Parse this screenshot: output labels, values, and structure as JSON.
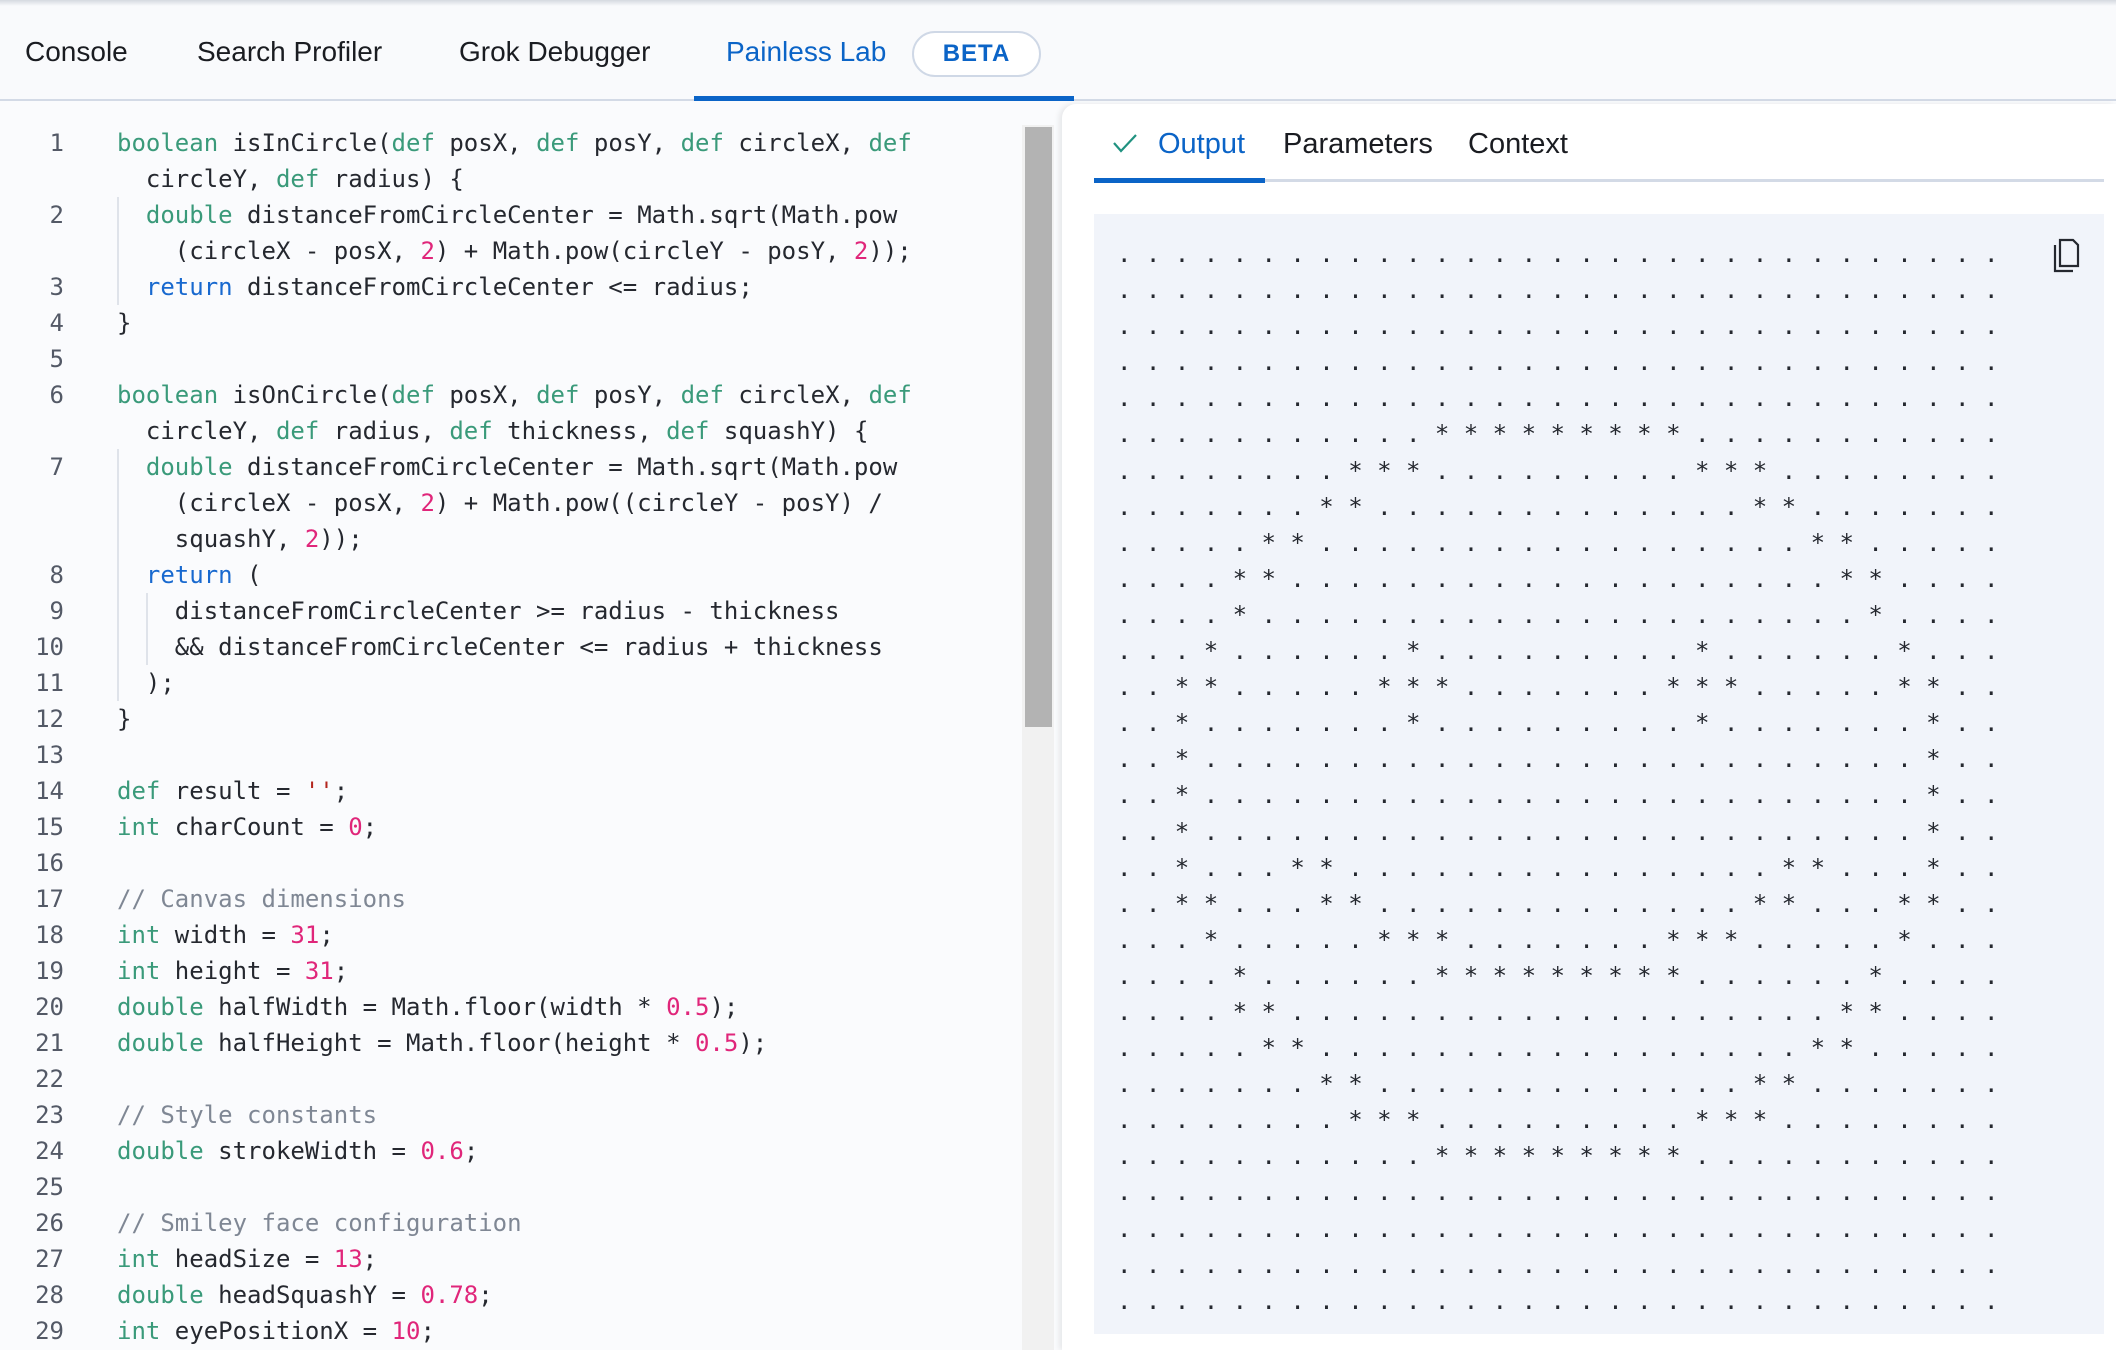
{
  "tabs": [
    {
      "label": "Console",
      "active": false
    },
    {
      "label": "Search Profiler",
      "active": false
    },
    {
      "label": "Grok Debugger",
      "active": false
    },
    {
      "label": "Painless Lab",
      "active": true
    }
  ],
  "beta_badge": "BETA",
  "colors": {
    "accent": "#0b64c7",
    "keyword": "#3a9a7a",
    "return_keyword": "#1869cf",
    "number": "#e0267a",
    "string": "#b3261e",
    "comment": "#7f8794",
    "output_bg": "#f1f4fa"
  },
  "editor": {
    "lines": [
      {
        "n": "1",
        "rows": [
          [
            [
              "k",
              "boolean"
            ],
            [
              "t",
              " isInCircle("
            ],
            [
              "k",
              "def"
            ],
            [
              "t",
              " posX, "
            ],
            [
              "k",
              "def"
            ],
            [
              "t",
              " posY, "
            ],
            [
              "k",
              "def"
            ],
            [
              "t",
              " circleX, "
            ],
            [
              "k",
              "def"
            ]
          ],
          [
            [
              "t",
              "circleY, "
            ],
            [
              "k",
              "def"
            ],
            [
              "t",
              " radius) {"
            ]
          ]
        ]
      },
      {
        "n": "2",
        "rows": [
          [
            [
              "t",
              "  "
            ],
            [
              "k",
              "double"
            ],
            [
              "t",
              " distanceFromCircleCenter = Math.sqrt(Math.pow"
            ]
          ],
          [
            [
              "t",
              "(circleX - posX, "
            ],
            [
              "n",
              "2"
            ],
            [
              "t",
              ") + Math.pow(circleY - posY, "
            ],
            [
              "n",
              "2"
            ],
            [
              "t",
              "));"
            ]
          ]
        ]
      },
      {
        "n": "3",
        "rows": [
          [
            [
              "t",
              "  "
            ],
            [
              "r",
              "return"
            ],
            [
              "t",
              " distanceFromCircleCenter <= radius;"
            ]
          ]
        ]
      },
      {
        "n": "4",
        "rows": [
          [
            [
              "t",
              "}"
            ]
          ]
        ]
      },
      {
        "n": "5",
        "rows": [
          []
        ]
      },
      {
        "n": "6",
        "rows": [
          [
            [
              "k",
              "boolean"
            ],
            [
              "t",
              " isOnCircle("
            ],
            [
              "k",
              "def"
            ],
            [
              "t",
              " posX, "
            ],
            [
              "k",
              "def"
            ],
            [
              "t",
              " posY, "
            ],
            [
              "k",
              "def"
            ],
            [
              "t",
              " circleX, "
            ],
            [
              "k",
              "def"
            ]
          ],
          [
            [
              "t",
              "circleY, "
            ],
            [
              "k",
              "def"
            ],
            [
              "t",
              " radius, "
            ],
            [
              "k",
              "def"
            ],
            [
              "t",
              " thickness, "
            ],
            [
              "k",
              "def"
            ],
            [
              "t",
              " squashY) {"
            ]
          ]
        ]
      },
      {
        "n": "7",
        "rows": [
          [
            [
              "t",
              "  "
            ],
            [
              "k",
              "double"
            ],
            [
              "t",
              " distanceFromCircleCenter = Math.sqrt(Math.pow"
            ]
          ],
          [
            [
              "t",
              "(circleX - posX, "
            ],
            [
              "n",
              "2"
            ],
            [
              "t",
              ") + Math.pow((circleY - posY) /"
            ]
          ],
          [
            [
              "t",
              "squashY, "
            ],
            [
              "n",
              "2"
            ],
            [
              "t",
              "));"
            ]
          ]
        ]
      },
      {
        "n": "8",
        "rows": [
          [
            [
              "t",
              "  "
            ],
            [
              "r",
              "return"
            ],
            [
              "t",
              " ("
            ]
          ]
        ]
      },
      {
        "n": "9",
        "rows": [
          [
            [
              "t",
              "    distanceFromCircleCenter >= radius - thickness"
            ]
          ]
        ]
      },
      {
        "n": "10",
        "rows": [
          [
            [
              "t",
              "    && distanceFromCircleCenter <= radius + thickness"
            ]
          ]
        ]
      },
      {
        "n": "11",
        "rows": [
          [
            [
              "t",
              "  );"
            ]
          ]
        ]
      },
      {
        "n": "12",
        "rows": [
          [
            [
              "t",
              "}"
            ]
          ]
        ]
      },
      {
        "n": "13",
        "rows": [
          []
        ]
      },
      {
        "n": "14",
        "rows": [
          [
            [
              "k",
              "def"
            ],
            [
              "t",
              " result = "
            ],
            [
              "s",
              "''"
            ],
            [
              "t",
              ";"
            ]
          ]
        ]
      },
      {
        "n": "15",
        "rows": [
          [
            [
              "k",
              "int"
            ],
            [
              "t",
              " charCount = "
            ],
            [
              "n",
              "0"
            ],
            [
              "t",
              ";"
            ]
          ]
        ]
      },
      {
        "n": "16",
        "rows": [
          []
        ]
      },
      {
        "n": "17",
        "rows": [
          [
            [
              "c",
              "// Canvas dimensions"
            ]
          ]
        ]
      },
      {
        "n": "18",
        "rows": [
          [
            [
              "k",
              "int"
            ],
            [
              "t",
              " width = "
            ],
            [
              "n",
              "31"
            ],
            [
              "t",
              ";"
            ]
          ]
        ]
      },
      {
        "n": "19",
        "rows": [
          [
            [
              "k",
              "int"
            ],
            [
              "t",
              " height = "
            ],
            [
              "n",
              "31"
            ],
            [
              "t",
              ";"
            ]
          ]
        ]
      },
      {
        "n": "20",
        "rows": [
          [
            [
              "k",
              "double"
            ],
            [
              "t",
              " halfWidth = Math.floor(width * "
            ],
            [
              "n",
              "0.5"
            ],
            [
              "t",
              ");"
            ]
          ]
        ]
      },
      {
        "n": "21",
        "rows": [
          [
            [
              "k",
              "double"
            ],
            [
              "t",
              " halfHeight = Math.floor(height * "
            ],
            [
              "n",
              "0.5"
            ],
            [
              "t",
              ");"
            ]
          ]
        ]
      },
      {
        "n": "22",
        "rows": [
          []
        ]
      },
      {
        "n": "23",
        "rows": [
          [
            [
              "c",
              "// Style constants"
            ]
          ]
        ]
      },
      {
        "n": "24",
        "rows": [
          [
            [
              "k",
              "double"
            ],
            [
              "t",
              " strokeWidth = "
            ],
            [
              "n",
              "0.6"
            ],
            [
              "t",
              ";"
            ]
          ]
        ]
      },
      {
        "n": "25",
        "rows": [
          []
        ]
      },
      {
        "n": "26",
        "rows": [
          [
            [
              "c",
              "// Smiley face configuration"
            ]
          ]
        ]
      },
      {
        "n": "27",
        "rows": [
          [
            [
              "k",
              "int"
            ],
            [
              "t",
              " headSize = "
            ],
            [
              "n",
              "13"
            ],
            [
              "t",
              ";"
            ]
          ]
        ]
      },
      {
        "n": "28",
        "rows": [
          [
            [
              "k",
              "double"
            ],
            [
              "t",
              " headSquashY = "
            ],
            [
              "n",
              "0.78"
            ],
            [
              "t",
              ";"
            ]
          ]
        ]
      },
      {
        "n": "29",
        "rows": [
          [
            [
              "k",
              "int"
            ],
            [
              "t",
              " eyePositionX = "
            ],
            [
              "n",
              "10"
            ],
            [
              "t",
              ";"
            ]
          ]
        ]
      }
    ]
  },
  "output_panel": {
    "tabs": [
      {
        "label": "Output",
        "active": true,
        "icon": "check-icon"
      },
      {
        "label": "Parameters",
        "active": false
      },
      {
        "label": "Context",
        "active": false
      }
    ],
    "copy_icon": "copy-icon",
    "lines": [
      ". . . . . . . . . . . . . . . . . . . . . . . . . . . . . . .",
      ". . . . . . . . . . . . . . . . . . . . . . . . . . . . . . .",
      ". . . . . . . . . . . . . . . . . . . . . . . . . . . . . . .",
      ". . . . . . . . . . . . . . . . . . . . . . . . . . . . . . .",
      ". . . . . . . . . . . . . . . . . . . . . . . . . . . . . . .",
      ". . . . . . . . . . . * * * * * * * * * . . . . . . . . . . .",
      ". . . . . . . . * * * . . . . . . . . . * * * . . . . . . . .",
      ". . . . . . . * * . . . . . . . . . . . . . * * . . . . . . .",
      ". . . . . * * . . . . . . . . . . . . . . . . . * * . . . . .",
      ". . . . * * . . . . . . . . . . . . . . . . . . . * * . . . .",
      ". . . . * . . . . . . . . . . . . . . . . . . . . . * . . . .",
      ". . . * . . . . . . * . . . . . . . . . * . . . . . . * . . .",
      ". . * * . . . . . * * * . . . . . . . * * * . . . . . * * . .",
      ". . * . . . . . . . * . . . . . . . . . * . . . . . . . * . .",
      ". . * . . . . . . . . . . . . . . . . . . . . . . . . . * . .",
      ". . * . . . . . . . . . . . . . . . . . . . . . . . . . * . .",
      ". . * . . . . . . . . . . . . . . . . . . . . . . . . . * . .",
      ". . * . . . * * . . . . . . . . . . . . . . . * * . . . * . .",
      ". . * * . . . * * . . . . . . . . . . . . . * * . . . * * . .",
      ". . . * . . . . . * * * . . . . . . . * * * . . . . . * . . .",
      ". . . . * . . . . . . * * * * * * * * * . . . . . . * . . . .",
      ". . . . * * . . . . . . . . . . . . . . . . . . . * * . . . .",
      ". . . . . * * . . . . . . . . . . . . . . . . . * * . . . . .",
      ". . . . . . . * * . . . . . . . . . . . . . * * . . . . . . .",
      ". . . . . . . . * * * . . . . . . . . . * * * . . . . . . . .",
      ". . . . . . . . . . . * * * * * * * * * . . . . . . . . . . .",
      ". . . . . . . . . . . . . . . . . . . . . . . . . . . . . . .",
      ". . . . . . . . . . . . . . . . . . . . . . . . . . . . . . .",
      ". . . . . . . . . . . . . . . . . . . . . . . . . . . . . . .",
      ". . . . . . . . . . . . . . . . . . . . . . . . . . . . . . ."
    ]
  }
}
